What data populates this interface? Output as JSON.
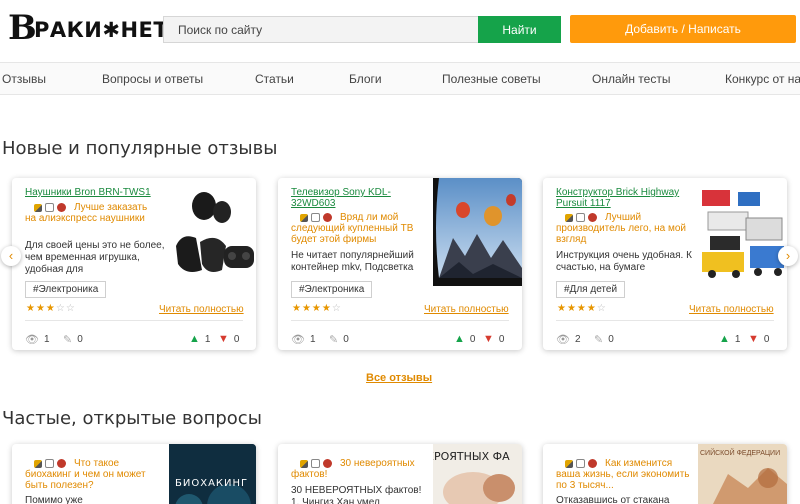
{
  "header": {
    "logo_letter": "В",
    "logo_rest": "РАКИ✱НЕТ",
    "search_placeholder": "Поиск по сайту",
    "search_button": "Найти",
    "add_button": "Добавить / Написать"
  },
  "nav": [
    "Отзывы",
    "Вопросы и ответы",
    "Статьи",
    "Блоги",
    "Полезные советы",
    "Онлайн тесты",
    "Конкурс от нас"
  ],
  "sections": {
    "reviews_title": "Новые и популярные отзывы",
    "all_reviews": "Все отзывы",
    "questions_title": "Частые, открытые вопросы"
  },
  "reviews": [
    {
      "title": "Наушники Bron BRN-TWS1",
      "subtitle": "Лучше заказать на алиэкспресс наушники",
      "desc": "Для своей цены это не более, чем временная игрушка, удобная для",
      "tag": "#Электроника",
      "rating": "3",
      "stars_on": "★★★",
      "stars_off": "☆☆",
      "read_more": "Читать полностью",
      "views": "1",
      "comments": "0",
      "likes": "1",
      "dislikes": "0"
    },
    {
      "title": "Телевизор Sony KDL-32WD603",
      "subtitle": "Вряд ли мой следующий купленный ТВ будет этой фирмы",
      "desc": "Не читает популярнейший контейнер mkv, Подсветка",
      "tag": "#Электроника",
      "rating": "4",
      "stars_on": "★★★★",
      "stars_off": "☆",
      "read_more": "Читать полностью",
      "views": "1",
      "comments": "0",
      "likes": "0",
      "dislikes": "0"
    },
    {
      "title": "Конструктор Brick Highway Pursuit 1117",
      "subtitle": "Лучший производитель лего, на мой взгляд",
      "desc": "Инструкция очень удобная. К счастью, на бумаге",
      "tag": "#Для детей",
      "rating": "4",
      "stars_on": "★★★★",
      "stars_off": "☆",
      "read_more": "Читать полностью",
      "views": "2",
      "comments": "0",
      "likes": "1",
      "dislikes": "0"
    }
  ],
  "questions": [
    {
      "subtitle": "Что такое биохакинг и чем он может быть полезен?",
      "desc": "Помимо уже",
      "image_text": "БИОХАКИНГ"
    },
    {
      "subtitle": "30 невероятных фактов!",
      "desc": "30 НЕВЕРОЯТНЫХ фактов! 1. Чингиз Хан умел",
      "image_text": "ЕРОЯТНЫХ ФА"
    },
    {
      "subtitle": "Как изменится ваша жизнь, если экономить по 3 тысяч...",
      "desc": "Отказавшись от стакана",
      "image_text": "СИЙСКОЙ ФЕДЕРАЦИИ"
    }
  ],
  "colors": {
    "green": "#15a34a",
    "orange": "#ff9a0c",
    "link_green": "#1a8a3e",
    "link_orange": "#e08a00"
  }
}
